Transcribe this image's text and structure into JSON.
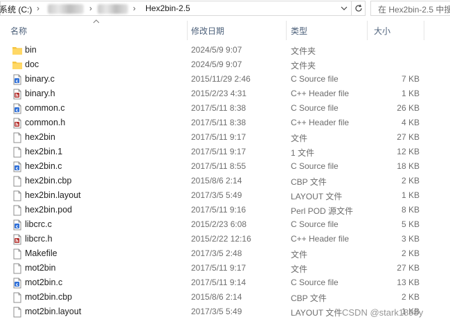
{
  "address": {
    "segments": [
      "系统 (C:)",
      "Hex2bin-2.5"
    ],
    "search_placeholder": "在 Hex2bin-2.5 中搜"
  },
  "columns": {
    "name": "名称",
    "date": "修改日期",
    "type": "类型",
    "size": "大小"
  },
  "files": [
    {
      "name": "bin",
      "date": "2024/5/9 9:07",
      "type": "文件夹",
      "size": "",
      "icon": "folder-icon"
    },
    {
      "name": "doc",
      "date": "2024/5/9 9:07",
      "type": "文件夹",
      "size": "",
      "icon": "folder-icon"
    },
    {
      "name": "binary.c",
      "date": "2015/11/29 2:46",
      "type": "C Source file",
      "size": "7 KB",
      "icon": "c-file-icon"
    },
    {
      "name": "binary.h",
      "date": "2015/2/23 4:31",
      "type": "C++ Header file",
      "size": "1 KB",
      "icon": "h-file-icon"
    },
    {
      "name": "common.c",
      "date": "2017/5/11 8:38",
      "type": "C Source file",
      "size": "26 KB",
      "icon": "c-file-icon"
    },
    {
      "name": "common.h",
      "date": "2017/5/11 8:38",
      "type": "C++ Header file",
      "size": "4 KB",
      "icon": "h-file-icon"
    },
    {
      "name": "hex2bin",
      "date": "2017/5/11 9:17",
      "type": "文件",
      "size": "27 KB",
      "icon": "file-icon"
    },
    {
      "name": "hex2bin.1",
      "date": "2017/5/11 9:17",
      "type": "1 文件",
      "size": "12 KB",
      "icon": "file-icon"
    },
    {
      "name": "hex2bin.c",
      "date": "2017/5/11 8:55",
      "type": "C Source file",
      "size": "18 KB",
      "icon": "c-file-icon"
    },
    {
      "name": "hex2bin.cbp",
      "date": "2015/8/6 2:14",
      "type": "CBP 文件",
      "size": "2 KB",
      "icon": "file-icon"
    },
    {
      "name": "hex2bin.layout",
      "date": "2017/3/5 5:49",
      "type": "LAYOUT 文件",
      "size": "1 KB",
      "icon": "file-icon"
    },
    {
      "name": "hex2bin.pod",
      "date": "2017/5/11 9:16",
      "type": "Perl POD 源文件",
      "size": "8 KB",
      "icon": "file-icon"
    },
    {
      "name": "libcrc.c",
      "date": "2015/2/23 6:08",
      "type": "C Source file",
      "size": "5 KB",
      "icon": "c-file-icon"
    },
    {
      "name": "libcrc.h",
      "date": "2015/2/22 12:16",
      "type": "C++ Header file",
      "size": "3 KB",
      "icon": "h-file-icon"
    },
    {
      "name": "Makefile",
      "date": "2017/3/5 2:48",
      "type": "文件",
      "size": "2 KB",
      "icon": "file-icon"
    },
    {
      "name": "mot2bin",
      "date": "2017/5/11 9:17",
      "type": "文件",
      "size": "27 KB",
      "icon": "file-icon"
    },
    {
      "name": "mot2bin.c",
      "date": "2017/5/11 9:14",
      "type": "C Source file",
      "size": "13 KB",
      "icon": "c-file-icon"
    },
    {
      "name": "mot2bin.cbp",
      "date": "2015/8/6 2:14",
      "type": "CBP 文件",
      "size": "2 KB",
      "icon": "file-icon"
    },
    {
      "name": "mot2bin.layout",
      "date": "2017/3/5 5:49",
      "type": "LAYOUT 文件",
      "size": "1 KB",
      "icon": "file-icon"
    }
  ],
  "watermark": "CSDN @stark1898y",
  "colors": {
    "folder": "#f5c542",
    "header_text": "#4c607a",
    "c_badge": "#2e6fd8",
    "h_badge": "#b5332f"
  }
}
